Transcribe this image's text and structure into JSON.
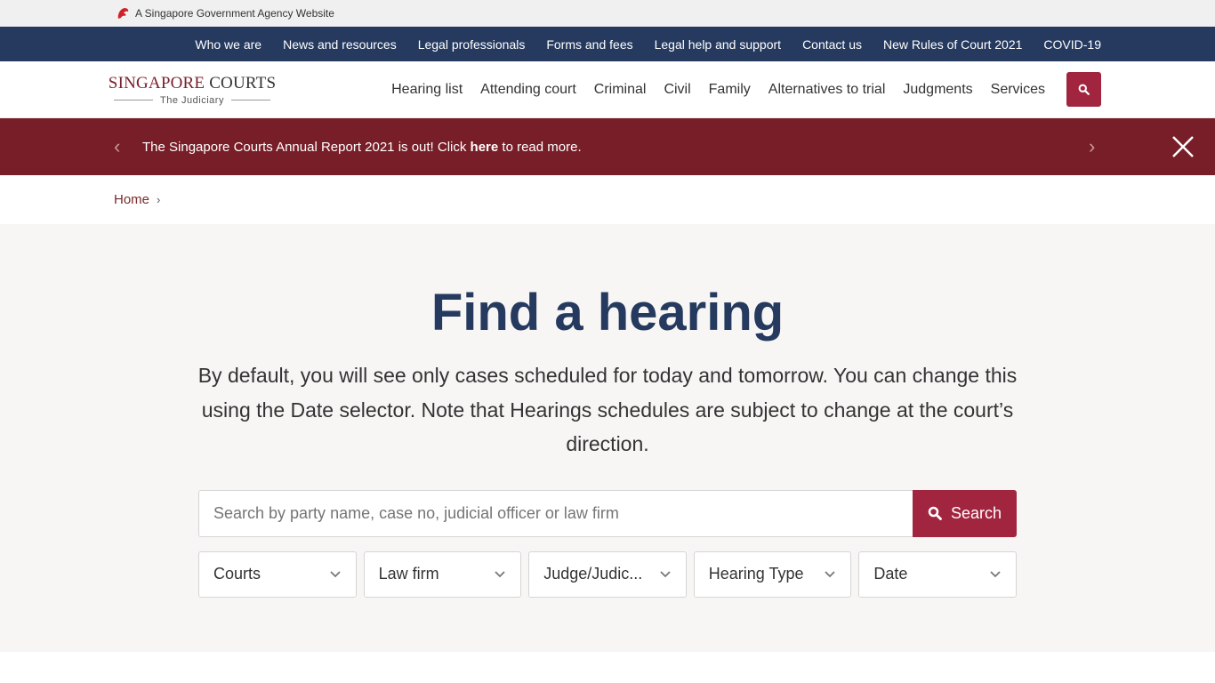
{
  "masthead": {
    "text": "A Singapore Government Agency Website",
    "icon": "lion-head-icon"
  },
  "topnav": {
    "items": [
      "Who we are",
      "News and resources",
      "Legal professionals",
      "Forms and fees",
      "Legal help and support",
      "Contact us",
      "New Rules of Court 2021",
      "COVID-19"
    ]
  },
  "header": {
    "logo_primary_a": "SINGAPORE",
    "logo_primary_b": "COURTS",
    "logo_sub": "The Judiciary",
    "nav": [
      "Hearing list",
      "Attending court",
      "Criminal",
      "Civil",
      "Family",
      "Alternatives to trial",
      "Judgments",
      "Services"
    ],
    "search_icon": "search-icon"
  },
  "banner": {
    "text_before": "The Singapore Courts Annual Report 2021 is out! Click ",
    "link": "here",
    "text_after": " to read more.",
    "prev": "‹",
    "next": "›"
  },
  "breadcrumb": {
    "home": "Home",
    "sep": "›"
  },
  "hero": {
    "title": "Find a hearing",
    "description": "By default, you will see only cases scheduled for today and tomorrow. You can change this using the Date selector. Note that Hearings schedules are subject to change at the court’s direction.",
    "search_placeholder": "Search by party name, case no, judicial officer or law firm",
    "search_value": "",
    "search_button": "Search",
    "filters": [
      "Courts",
      "Law firm",
      "Judge/Judic...",
      "Hearing Type",
      "Date"
    ]
  },
  "colors": {
    "navy": "#253a5e",
    "crimson": "#a2253f",
    "banner": "#781e28"
  }
}
